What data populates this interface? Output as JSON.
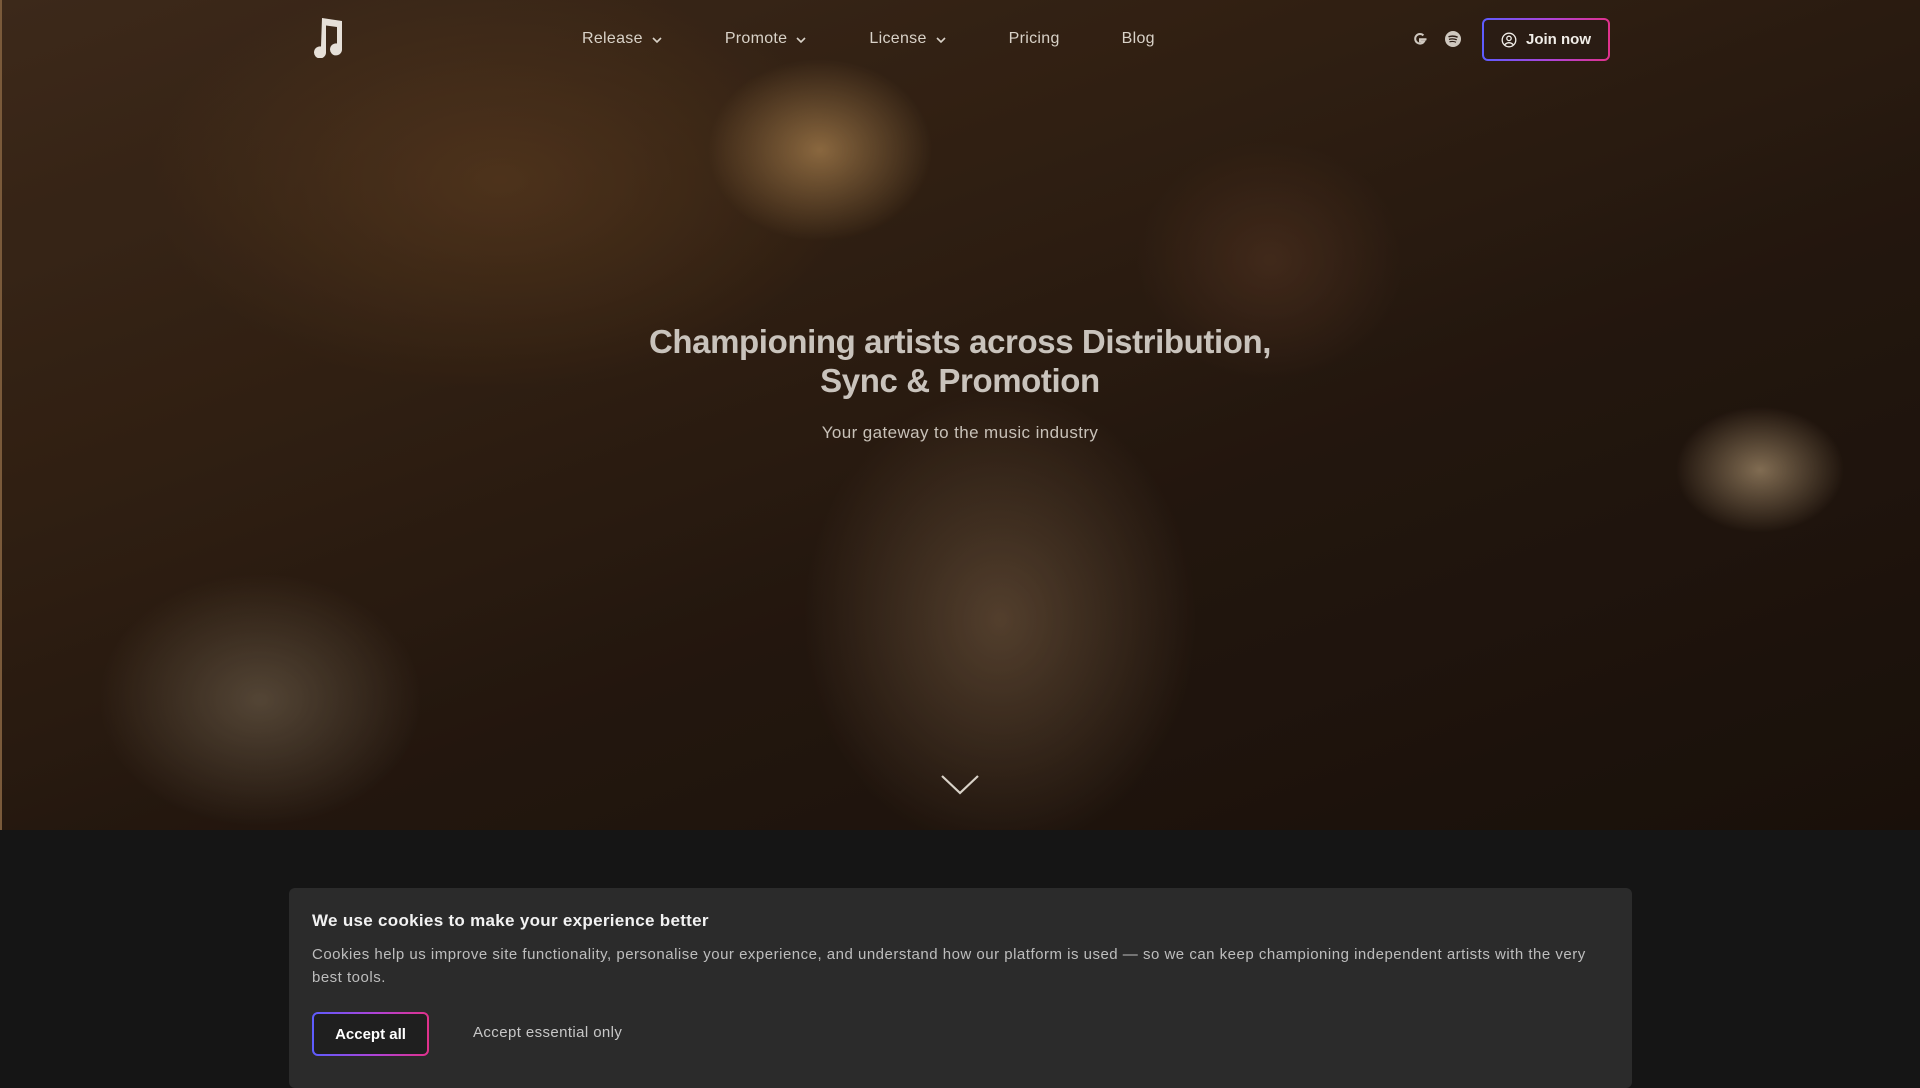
{
  "nav": {
    "items": [
      {
        "label": "Release",
        "has_dropdown": true
      },
      {
        "label": "Promote",
        "has_dropdown": true
      },
      {
        "label": "License",
        "has_dropdown": true
      },
      {
        "label": "Pricing",
        "has_dropdown": false
      },
      {
        "label": "Blog",
        "has_dropdown": false
      }
    ],
    "icons": [
      "music-note-logo-icon",
      "google-icon",
      "spotify-icon",
      "user-circle-icon",
      "chevron-down-icon"
    ],
    "join_label": "Join now"
  },
  "hero": {
    "headline_line1": "Championing artists across Distribution,",
    "headline_line2": "Sync & Promotion",
    "subheadline": "Your gateway to the music industry"
  },
  "cookie_banner": {
    "title": "We use cookies to make your experience better",
    "text": "Cookies help us improve site functionality, personalise your experience, and understand how our platform is used — so we can keep championing independent artists with the very best tools.",
    "accept_all_label": "Accept all",
    "accept_essential_label": "Accept essential only"
  },
  "colors": {
    "accent_gradient_start": "#5d5cff",
    "accent_gradient_mid": "#b043d6",
    "accent_gradient_end": "#e0318b",
    "page_background": "#151515",
    "banner_background": "#2b2b2b"
  }
}
